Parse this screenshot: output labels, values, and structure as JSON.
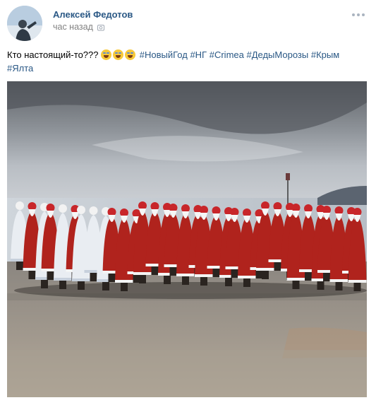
{
  "post": {
    "author_name": "Алексей Федотов",
    "time": "час назад",
    "text_prefix": "Кто настоящий-то???",
    "emoji_count": 3,
    "hashtags": [
      "#НовыйГод",
      "#НГ",
      "#Crimea",
      "#ДедыМорозы",
      "#Крым",
      "#Ялта"
    ]
  },
  "icons": {
    "camera": "camera-icon",
    "more": "more-dots-icon",
    "emoji": "laughing-tears-emoji-icon"
  },
  "colors": {
    "link": "#2a5885",
    "meta": "#828282"
  }
}
